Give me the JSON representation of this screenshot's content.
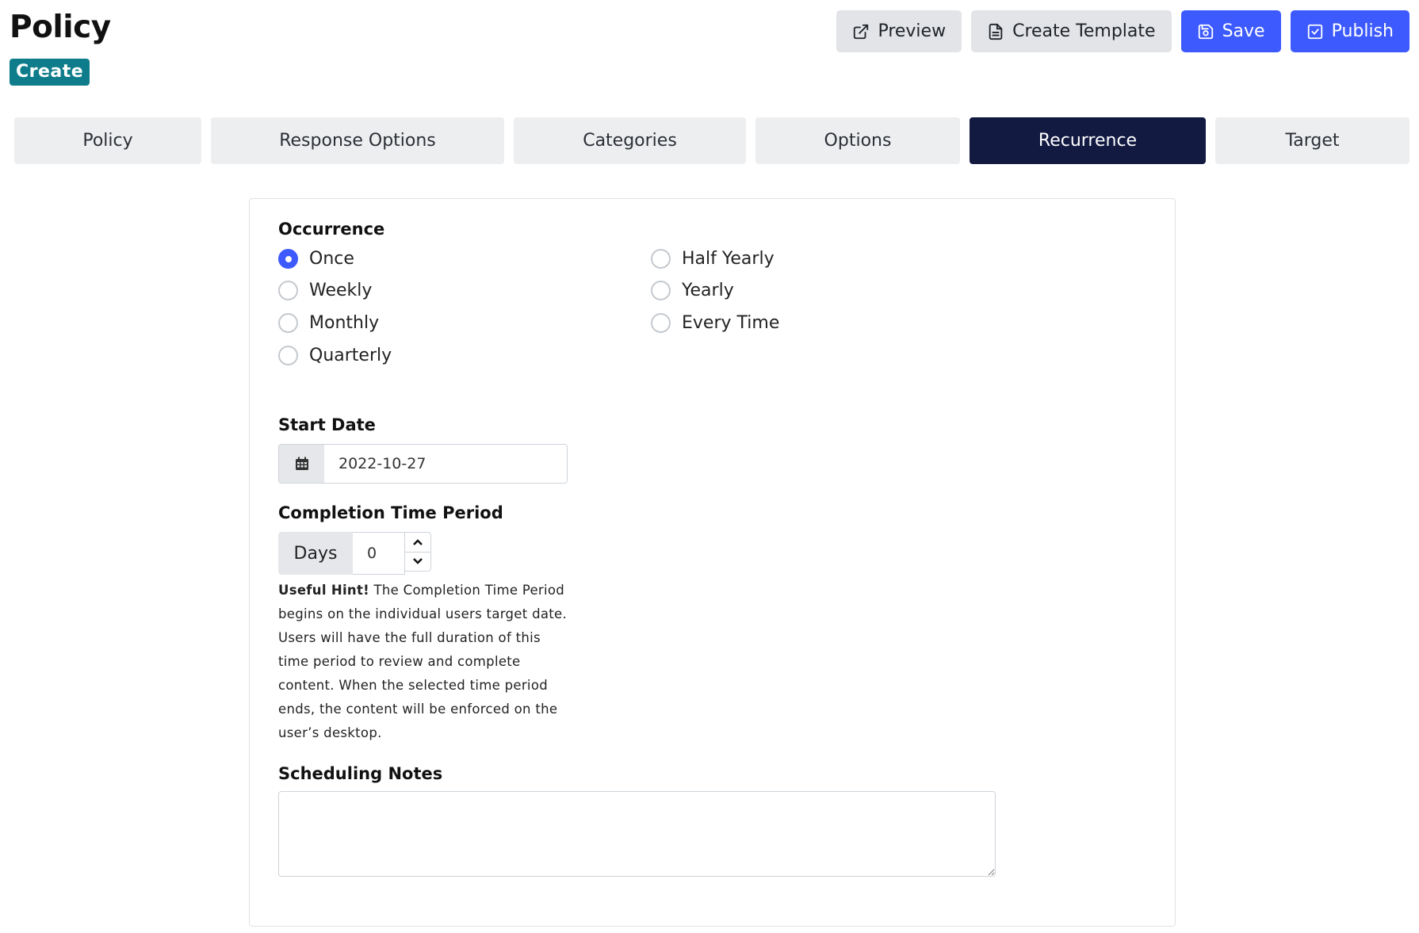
{
  "header": {
    "title": "Policy",
    "badge": "Create"
  },
  "actions": [
    {
      "label": "Preview",
      "icon": "external-link-icon"
    },
    {
      "label": "Create Template",
      "icon": "document-icon"
    },
    {
      "label": "Save",
      "icon": "floppy-disk-icon"
    },
    {
      "label": "Publish",
      "icon": "check-square-icon"
    }
  ],
  "tabs": [
    {
      "label": "Policy"
    },
    {
      "label": "Response Options"
    },
    {
      "label": "Categories"
    },
    {
      "label": "Options"
    },
    {
      "label": "Recurrence",
      "active": true
    },
    {
      "label": "Target"
    }
  ],
  "occurrence": {
    "label": "Occurrence",
    "selected": "Once",
    "options": [
      "Once",
      "Weekly",
      "Monthly",
      "Quarterly",
      "Half Yearly",
      "Yearly",
      "Every Time"
    ]
  },
  "start_date": {
    "label": "Start Date",
    "value": "2022-10-27",
    "icon": "calendar-icon"
  },
  "completion": {
    "label": "Completion Time Period",
    "unit": "Days",
    "value": "0",
    "hint_title": "Useful Hint!",
    "hint_body": " The Completion Time Period begins on the individual users target date. Users will have the full duration of this time period to review and complete content. When the selected time period ends, the content will be enforced on the user’s desktop."
  },
  "notes": {
    "label": "Scheduling Notes",
    "value": ""
  },
  "colors": {
    "primary": "#3d5afe",
    "active_tab": "#121a42",
    "badge": "#0e7c8a"
  }
}
